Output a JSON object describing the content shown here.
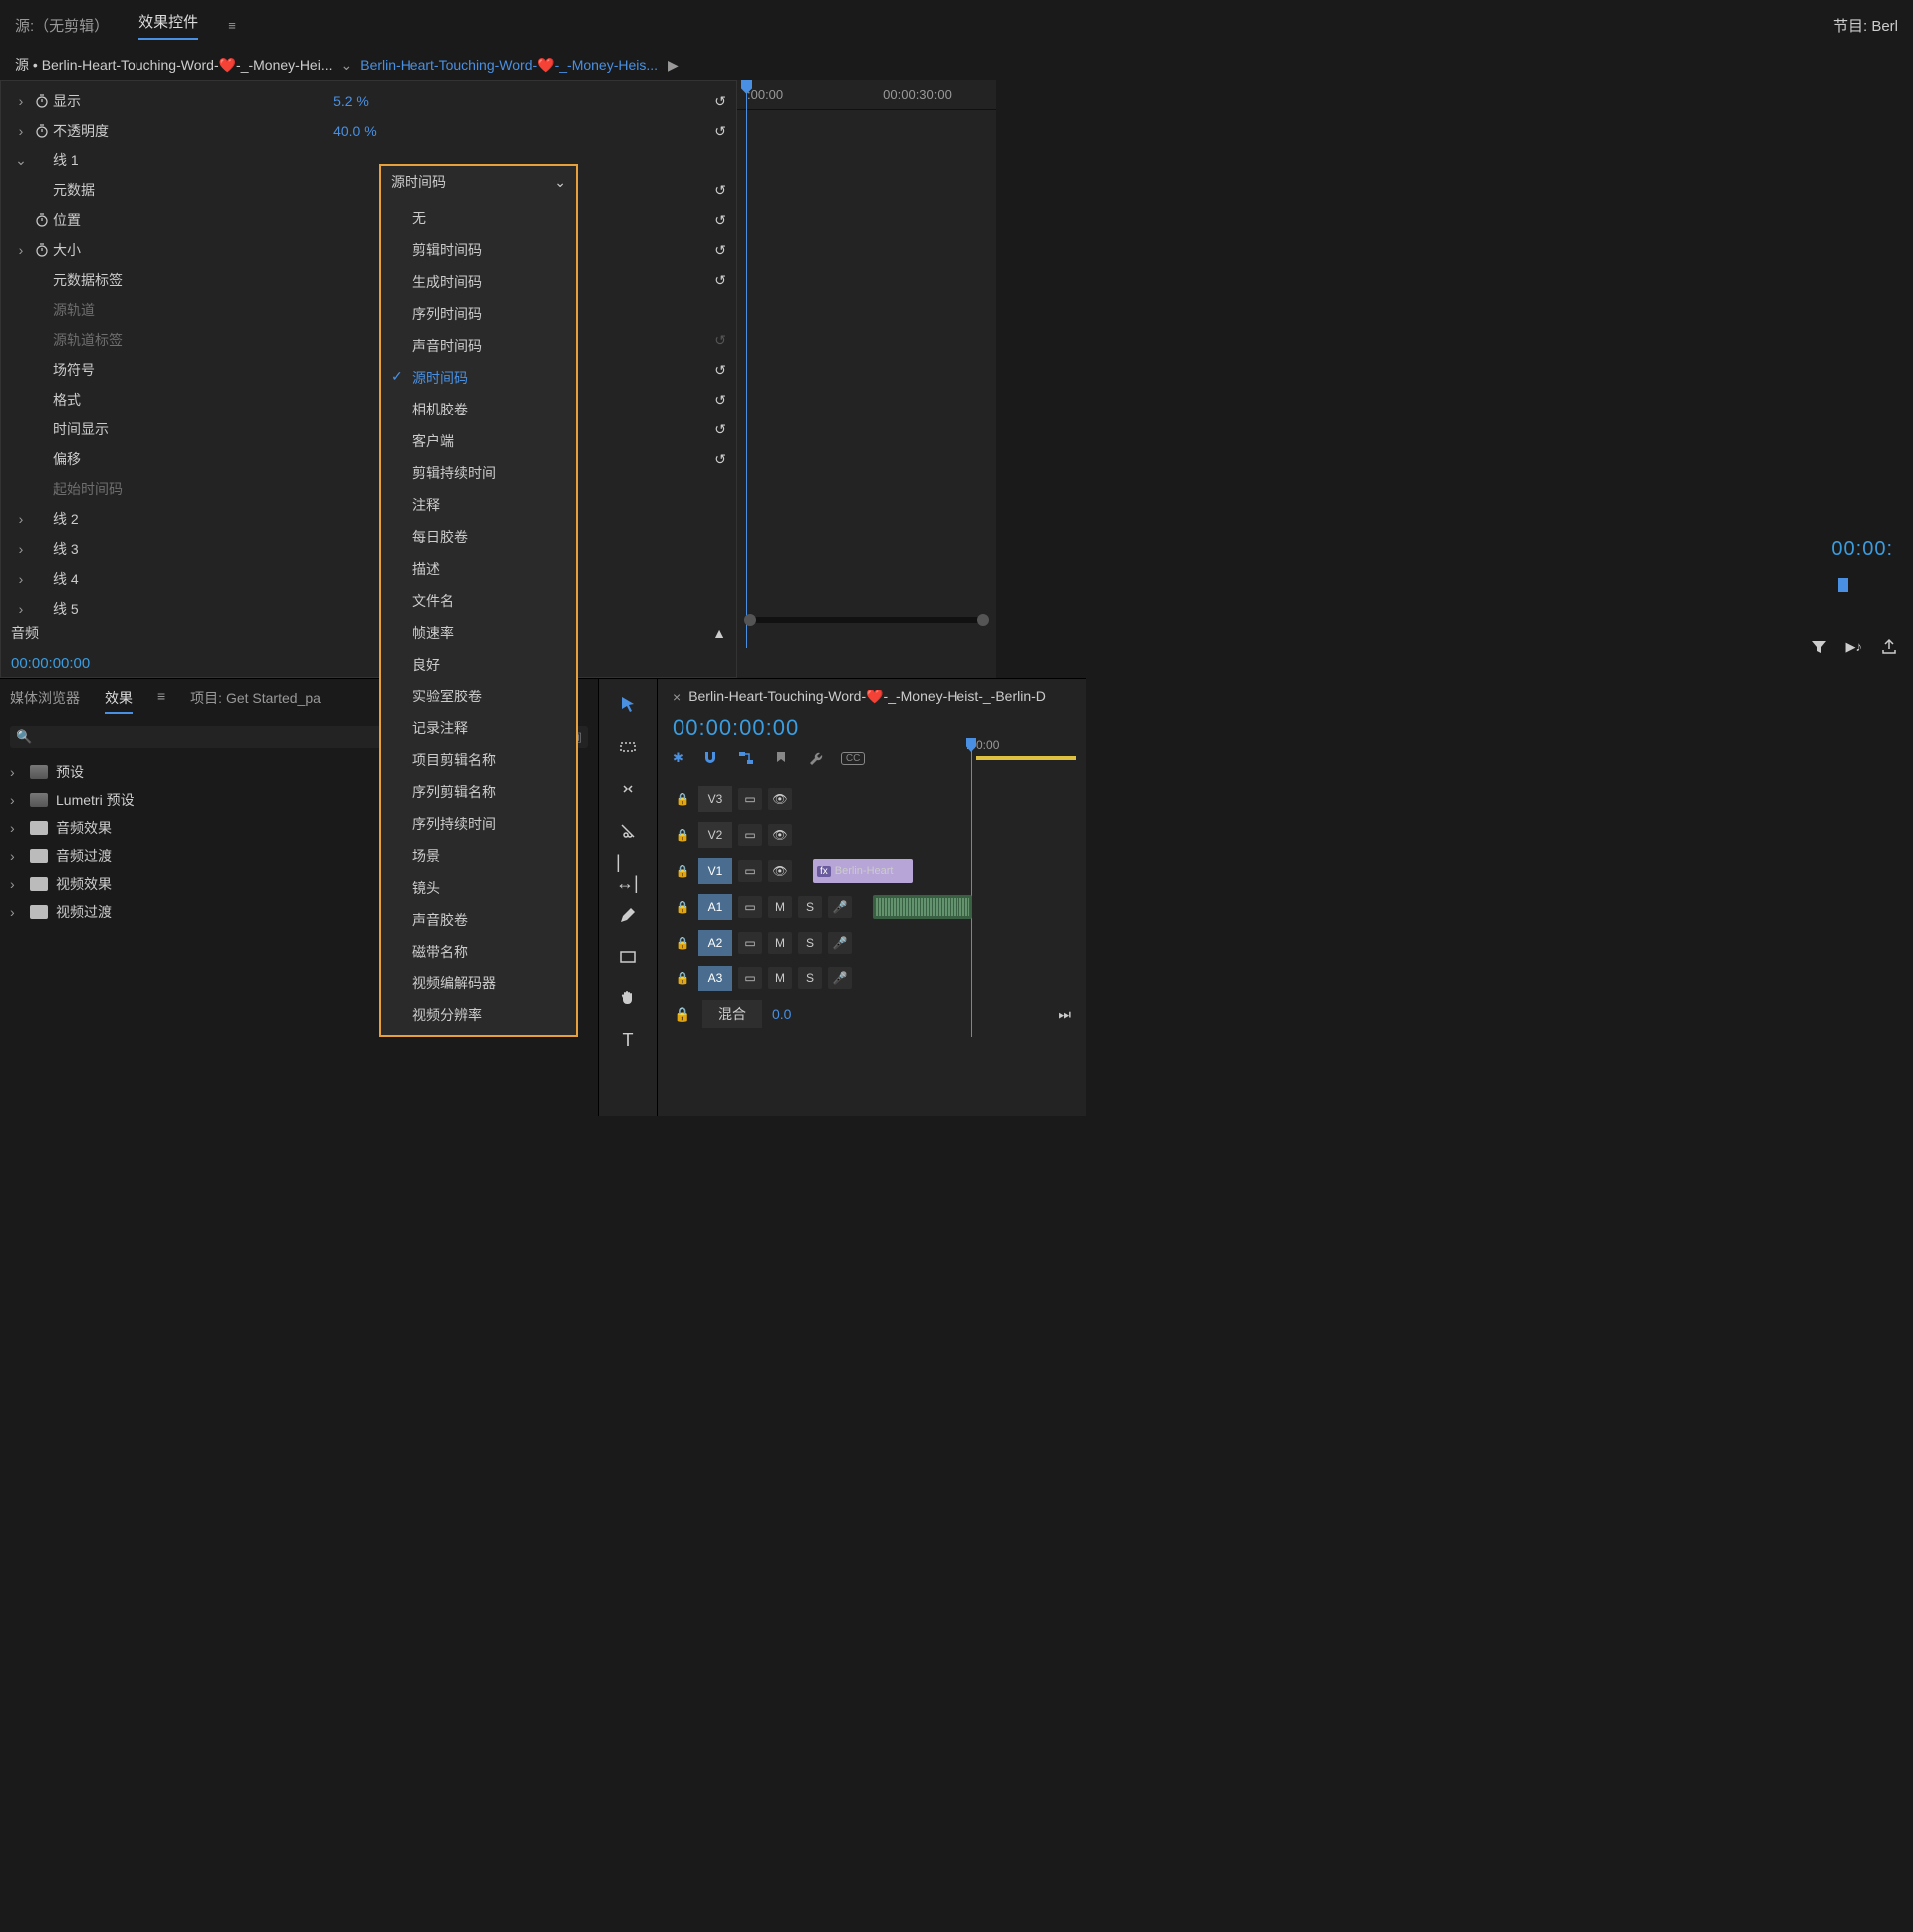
{
  "topTabs": {
    "source": "源:（无剪辑）",
    "effectControls": "效果控件"
  },
  "programLabel": "节目: Berl",
  "sourceRow": {
    "prefix": "源 •",
    "clipName": "Berlin-Heart-Touching-Word-❤️-_-Money-Hei...",
    "seqName": "Berlin-Heart-Touching-Word-❤️-_-Money-Heis..."
  },
  "miniRuler": {
    "t1": ":00:00",
    "t2": "00:00:30:00"
  },
  "props": {
    "display": "显示",
    "displayVal": "5.2 %",
    "opacity": "不透明度",
    "opacityVal": "40.0 %",
    "line1": "线 1",
    "metadata": "元数据",
    "position": "位置",
    "size": "大小",
    "metadataLabel": "元数据标签",
    "sourceTrack": "源轨道",
    "sourceTrackLabel": "源轨道标签",
    "fieldSymbol": "场符号",
    "format": "格式",
    "timeDisplay": "时间显示",
    "offset": "偏移",
    "startTimecode": "起始时间码",
    "line2": "线 2",
    "line3": "线 3",
    "line4": "线 4",
    "line5": "线 5"
  },
  "audioLabel": "音频",
  "effectTimecode": "00:00:00:00",
  "programTimecode": "00:00:",
  "dropdown": {
    "selected": "源时间码",
    "items": [
      "无",
      "剪辑时间码",
      "生成时间码",
      "序列时间码",
      "声音时间码",
      "源时间码",
      "相机胶卷",
      "客户端",
      "剪辑持续时间",
      "注释",
      "每日胶卷",
      "描述",
      "文件名",
      "帧速率",
      "良好",
      "实验室胶卷",
      "记录注释",
      "项目剪辑名称",
      "序列剪辑名称",
      "序列持续时间",
      "场景",
      "镜头",
      "声音胶卷",
      "磁带名称",
      "视频编解码器",
      "视频分辨率"
    ],
    "checkedIndex": 5
  },
  "bottomTabs": {
    "mediaBrowser": "媒体浏览器",
    "effects": "效果",
    "project": "项目: Get Started_pa"
  },
  "folders": [
    "预设",
    "Lumetri 预设",
    "音频效果",
    "音频过渡",
    "视频效果",
    "视频过渡"
  ],
  "timeline": {
    "seqName": "Berlin-Heart-Touching-Word-❤️-_-Money-Heist-_-Berlin-D",
    "timecode": "00:00:00:00",
    "rulerLabel": ":00:00",
    "tracks": {
      "v3": "V3",
      "v2": "V2",
      "v1": "V1",
      "a1": "A1",
      "a2": "A2",
      "a3": "A3",
      "m": "M",
      "s": "S",
      "mix": "混合",
      "mixVal": "0.0"
    },
    "clipName": "Berlin-Heart",
    "fx": "fx"
  }
}
